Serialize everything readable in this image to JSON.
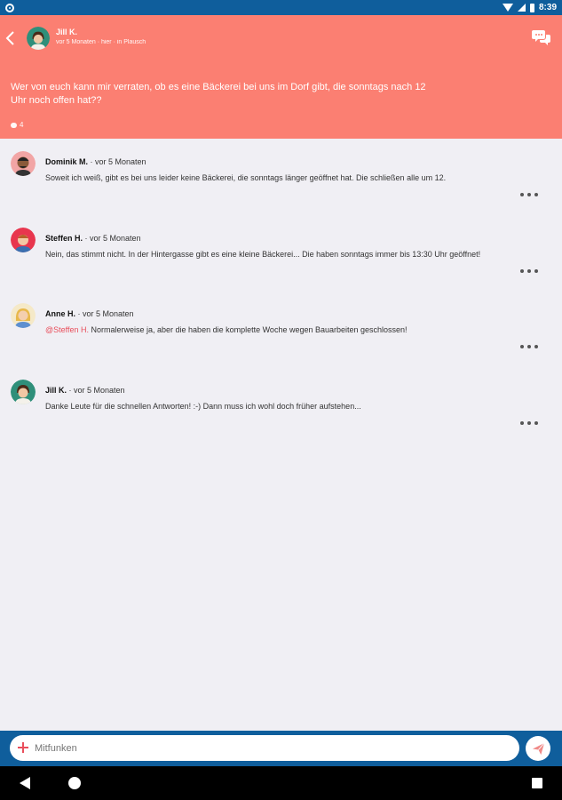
{
  "status_bar": {
    "time": "8:39"
  },
  "header": {
    "author": "Jill K.",
    "meta": "vor 5 Monaten · hier · in Plausch",
    "post_text": "Wer von euch kann mir verraten, ob es eine Bäckerei bei uns im Dorf gibt, die sonntags nach 12 Uhr noch offen hat??",
    "comment_count": "4"
  },
  "comments": [
    {
      "name": "Dominik M.",
      "time": "· vor 5 Monaten",
      "mention": "",
      "text": "Soweit ich weiß, gibt es bei uns leider keine Bäckerei, die sonntags länger geöffnet hat. Die schließen alle um 12."
    },
    {
      "name": "Steffen H.",
      "time": "· vor 5 Monaten",
      "mention": "",
      "text": "Nein, das stimmt nicht. In der Hintergasse gibt es eine kleine Bäckerei... Die haben sonntags immer bis 13:30 Uhr geöffnet!"
    },
    {
      "name": "Anne H.",
      "time": "· vor 5 Monaten",
      "mention": "@Steffen H.",
      "text": " Normalerweise ja, aber die haben die komplette Woche wegen Bauarbeiten geschlossen!"
    },
    {
      "name": "Jill K.",
      "time": "· vor 5 Monaten",
      "mention": "",
      "text": "Danke Leute für die schnellen Antworten! :-) Dann muss ich wohl doch früher aufstehen..."
    }
  ],
  "input": {
    "placeholder": "Mitfunken"
  },
  "colors": {
    "header": "#fb7f72",
    "bars": "#0f5e9c",
    "accent": "#e94e5b",
    "background": "#f0eff4"
  },
  "icons": {
    "status": [
      "notification-icon",
      "wifi-icon",
      "signal-icon",
      "battery-icon"
    ],
    "header": [
      "back-arrow-icon",
      "chat-bubbles-icon",
      "comment-icon"
    ],
    "comments": [
      "more-dots-icon"
    ],
    "input": [
      "plus-icon",
      "send-icon"
    ],
    "nav": [
      "nav-back-icon",
      "nav-home-icon",
      "nav-recents-icon"
    ]
  }
}
